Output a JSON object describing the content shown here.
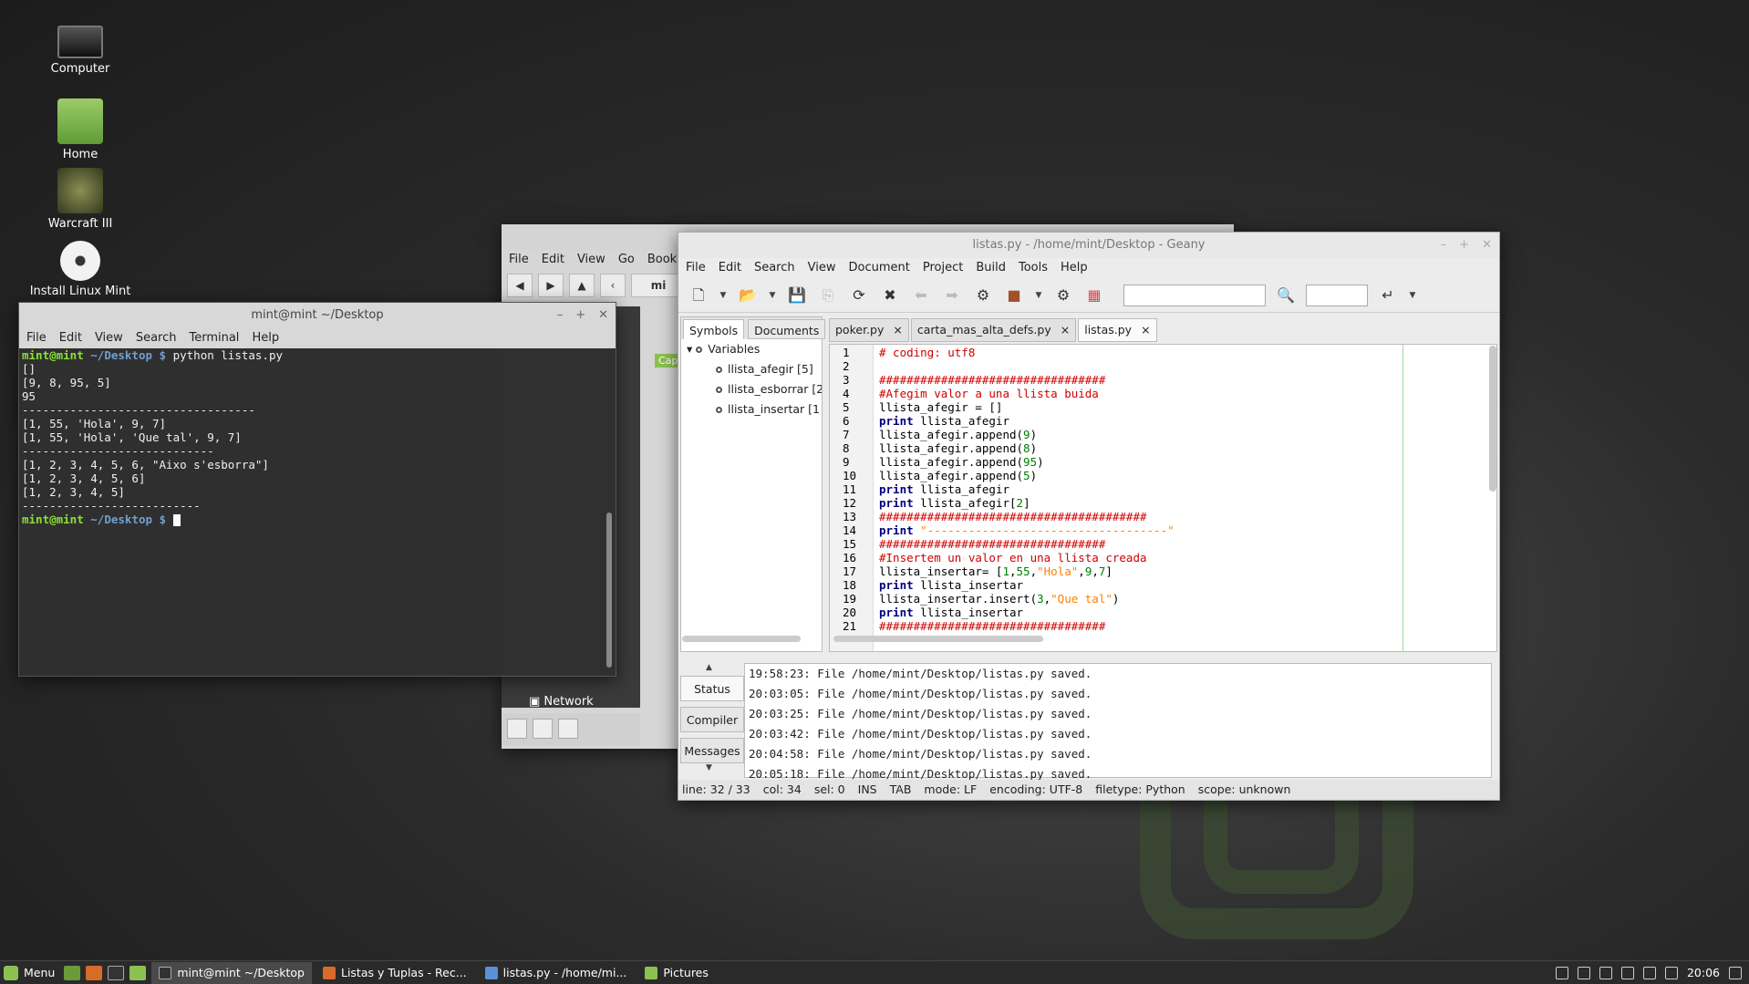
{
  "desktop": {
    "icons": [
      {
        "label": "Computer"
      },
      {
        "label": "Home"
      },
      {
        "label": "Warcraft III"
      },
      {
        "label": "Install Linux Mint"
      }
    ]
  },
  "file_manager": {
    "menu": [
      "File",
      "Edit",
      "View",
      "Go",
      "Bookmark"
    ],
    "location": "mi",
    "tag": "Cap",
    "network_label": "Network"
  },
  "terminal": {
    "title": "mint@mint ~/Desktop",
    "menu": [
      "File",
      "Edit",
      "View",
      "Search",
      "Terminal",
      "Help"
    ],
    "prompt_user": "mint@mint",
    "prompt_path": "~/Desktop $",
    "command": " python listas.py",
    "output": [
      "[]",
      "[9, 8, 95, 5]",
      "95",
      "----------------------------------",
      "[1, 55, 'Hola', 9, 7]",
      "[1, 55, 'Hola', 'Que tal', 9, 7]",
      "----------------------------",
      "[1, 2, 3, 4, 5, 6, \"Aixo s'esborra\"]",
      "[1, 2, 3, 4, 5, 6]",
      "[1, 2, 3, 4, 5]",
      "--------------------------"
    ]
  },
  "geany": {
    "title": "listas.py - /home/mint/Desktop - Geany",
    "menu": [
      "File",
      "Edit",
      "Search",
      "View",
      "Document",
      "Project",
      "Build",
      "Tools",
      "Help"
    ],
    "sidebar_tabs": [
      "Symbols",
      "Documents"
    ],
    "symbols_root": "Variables",
    "symbols": [
      "llista_afegir [5]",
      "llista_esborrar [2",
      "llista_insertar [1"
    ],
    "doc_tabs": [
      "poker.py",
      "carta_mas_alta_defs.py",
      "listas.py"
    ],
    "line_numbers": [
      "1",
      "2",
      "3",
      "4",
      "5",
      "6",
      "7",
      "8",
      "9",
      "10",
      "11",
      "12",
      "13",
      "14",
      "15",
      "16",
      "17",
      "18",
      "19",
      "20",
      "21"
    ],
    "msg_tabs": [
      "Status",
      "Compiler",
      "Messages"
    ],
    "messages": [
      "19:58:23: File /home/mint/Desktop/listas.py saved.",
      "20:03:05: File /home/mint/Desktop/listas.py saved.",
      "20:03:25: File /home/mint/Desktop/listas.py saved.",
      "20:03:42: File /home/mint/Desktop/listas.py saved.",
      "20:04:58: File /home/mint/Desktop/listas.py saved.",
      "20:05:18: File /home/mint/Desktop/listas.py saved."
    ],
    "status": {
      "line": "line: 32 / 33",
      "col": "col: 34",
      "sel": "sel: 0",
      "ins": "INS",
      "tab": "TAB",
      "mode": "mode: LF",
      "encoding": "encoding: UTF-8",
      "filetype": "filetype: Python",
      "scope": "scope: unknown"
    }
  },
  "taskbar": {
    "menu_label": "Menu",
    "tasks": [
      {
        "label": "mint@mint ~/Desktop"
      },
      {
        "label": "Listas y Tuplas - Rec..."
      },
      {
        "label": "listas.py - /home/mi..."
      },
      {
        "label": "Pictures"
      }
    ],
    "clock": "20:06"
  }
}
